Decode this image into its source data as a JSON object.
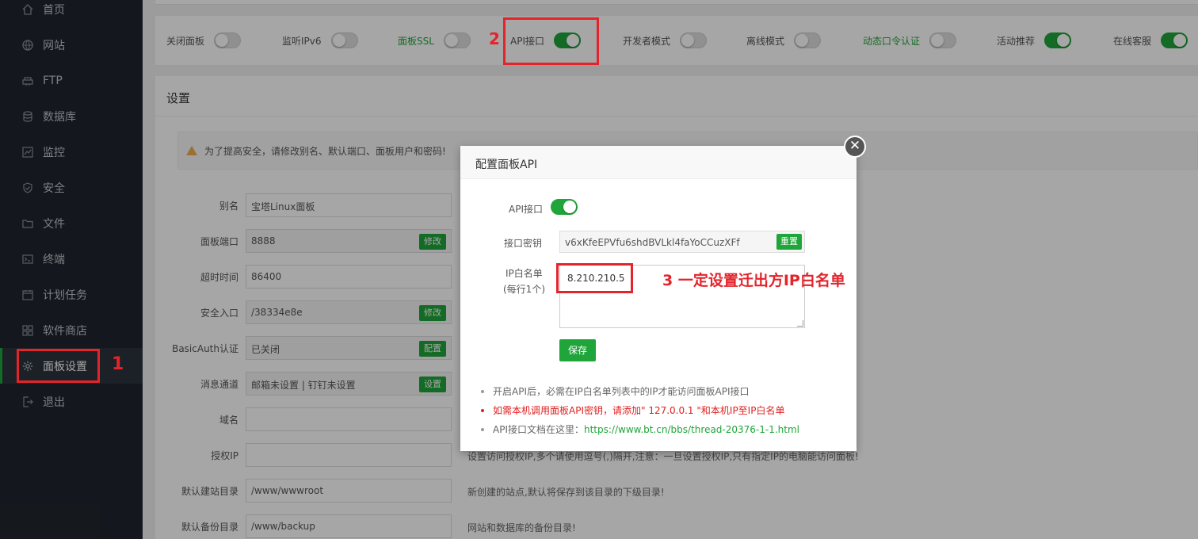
{
  "sidebar": {
    "items": [
      {
        "label": "首页",
        "icon": "home-icon"
      },
      {
        "label": "网站",
        "icon": "globe-icon"
      },
      {
        "label": "FTP",
        "icon": "ftp-icon"
      },
      {
        "label": "数据库",
        "icon": "database-icon"
      },
      {
        "label": "监控",
        "icon": "monitor-icon"
      },
      {
        "label": "安全",
        "icon": "shield-icon"
      },
      {
        "label": "文件",
        "icon": "folder-icon"
      },
      {
        "label": "终端",
        "icon": "terminal-icon"
      },
      {
        "label": "计划任务",
        "icon": "calendar-icon"
      },
      {
        "label": "软件商店",
        "icon": "grid-icon"
      },
      {
        "label": "面板设置",
        "icon": "gear-icon",
        "active": true
      },
      {
        "label": "退出",
        "icon": "logout-icon"
      }
    ]
  },
  "toggles": [
    {
      "label": "关闭面板",
      "on": false,
      "green_label": false
    },
    {
      "label": "监听IPv6",
      "on": false,
      "green_label": false
    },
    {
      "label": "面板SSL",
      "on": false,
      "green_label": true
    },
    {
      "label": "API接口",
      "on": true,
      "green_label": false
    },
    {
      "label": "开发者模式",
      "on": false,
      "green_label": false
    },
    {
      "label": "离线模式",
      "on": false,
      "green_label": false
    },
    {
      "label": "动态口令认证",
      "on": false,
      "green_label": true
    },
    {
      "label": "活动推荐",
      "on": true,
      "green_label": false
    },
    {
      "label": "在线客服",
      "on": true,
      "green_label": false
    }
  ],
  "settings": {
    "title": "设置",
    "alert": "为了提高安全，请修改别名、默认端口、面板用户和密码!",
    "rows": [
      {
        "label": "别名",
        "value": "宝塔Linux面板",
        "button": "",
        "hint": ""
      },
      {
        "label": "面板端口",
        "value": "8888",
        "button": "修改",
        "hint": ""
      },
      {
        "label": "超时时间",
        "value": "86400",
        "button": "",
        "hint": ""
      },
      {
        "label": "安全入口",
        "value": "/38334e8e",
        "button": "修改",
        "hint": ""
      },
      {
        "label": "BasicAuth认证",
        "value": "已关闭",
        "button": "配置",
        "hint": ""
      },
      {
        "label": "消息通道",
        "value": "邮箱未设置 | 钉钉未设置",
        "button": "设置",
        "hint": ""
      },
      {
        "label": "域名",
        "value": "",
        "button": "",
        "hint": ""
      },
      {
        "label": "授权IP",
        "value": "",
        "button": "",
        "hint": "设置访问授权IP,多个请使用逗号(,)隔开,注意：一旦设置授权IP,只有指定IP的电脑能访问面板!"
      },
      {
        "label": "默认建站目录",
        "value": "/www/wwwroot",
        "button": "",
        "hint": "新创建的站点,默认将保存到该目录的下级目录!"
      },
      {
        "label": "默认备份目录",
        "value": "/www/backup",
        "button": "",
        "hint": "网站和数据库的备份目录!"
      }
    ]
  },
  "modal": {
    "title": "配置面板API",
    "close_glyph": "✕",
    "api_label": "API接口",
    "api_on": true,
    "key_label": "接口密钥",
    "key_value": "v6xKfeEPVfu6shdBVLkl4faYoCCuzXFf",
    "reset_label": "重置",
    "whitelist_label": "IP白名单",
    "whitelist_sub": "(每行1个)",
    "whitelist_value": "8.210.210.5",
    "save_label": "保存",
    "notes": [
      "开启API后，必需在IP白名单列表中的IP才能访问面板API接口",
      "如需本机调用面板API密钥，请添加\" 127.0.0.1 \"和本机IP至IP白名单"
    ],
    "doc_prefix": "API接口文档在这里：",
    "doc_link": "https://www.bt.cn/bbs/thread-20376-1-1.html"
  },
  "annotations": {
    "step1": "1",
    "step2": "2",
    "step3": "3 一定设置迁出方IP白名单"
  },
  "colors": {
    "sidebar_bg": "#20262e",
    "accent_green": "#20a53a",
    "annotation_red": "#e3242b",
    "note_red": "#e02020"
  }
}
